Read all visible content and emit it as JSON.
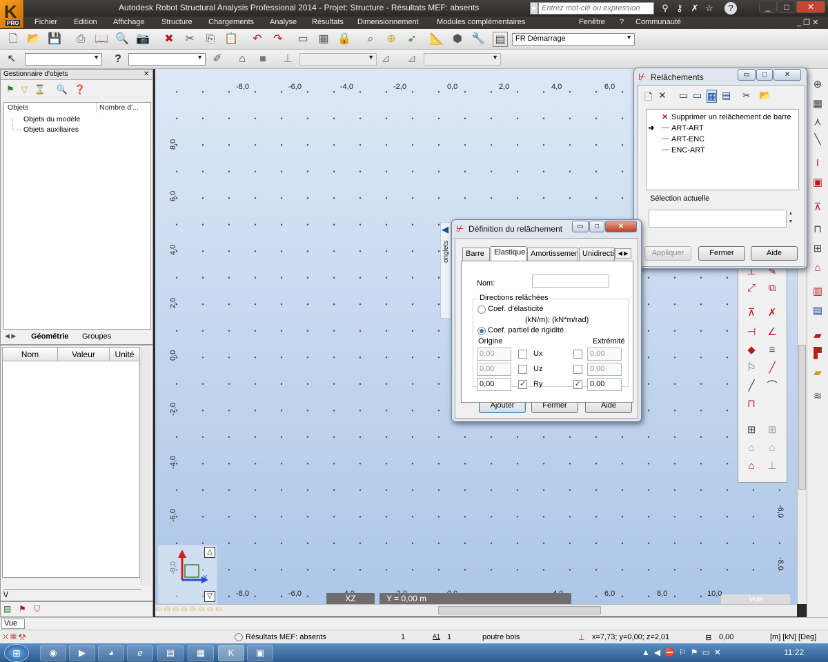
{
  "app": {
    "title": "Autodesk Robot Structural Analysis Professional 2014 - Projet: Structure - Résultats MEF: absents",
    "logo_letter": "K",
    "logo_badge": "PRO",
    "search_placeholder": "Entrez mot-clé ou expression",
    "window_controls": [
      "_",
      "□",
      "✕"
    ]
  },
  "menu": [
    "Fichier",
    "Edition",
    "Affichage",
    "Structure",
    "Chargements",
    "Analyse",
    "Résultats",
    "Dimensionnement",
    "Modules complémentaires",
    "Fenêtre",
    "?",
    "Communauté"
  ],
  "toolbar": {
    "workspace_combo": "FR Démarrage",
    "label_question": "?"
  },
  "object_manager": {
    "title": "Gestionnaire d'objets",
    "col_objects": "Objets",
    "col_count": "Nombre d'...",
    "items": [
      "Objets du modèle",
      "Objets auxiliaires"
    ],
    "tabs": [
      "Géométrie",
      "Groupes"
    ]
  },
  "properties": {
    "col_name": "Nom",
    "col_value": "Valeur",
    "col_unit": "Unité"
  },
  "canvas": {
    "top_ruler": [
      "-8,0",
      "-6,0",
      "-4,0",
      "-2,0",
      "0,0",
      "2,0",
      "4,0",
      "6,0"
    ],
    "left_ruler": [
      "8,0",
      "6,0",
      "4,0",
      "2,0",
      "0,0",
      "-2,0",
      "-4,0",
      "-6,0",
      "-8,0"
    ],
    "right_ruler": [
      "-6,0",
      "-8,0"
    ],
    "bottom_ruler": [
      "-8,0",
      "-6,0",
      "-4,0",
      "-2,0",
      "0,0",
      "4,0",
      "6,0",
      "8,0",
      "10,0"
    ],
    "view_plane": "XZ",
    "view_y": "Y = 0,00 m",
    "view_label": "Vue",
    "axis_z": "Z",
    "axis_x": "X",
    "side_tab": "onglets"
  },
  "releases_window": {
    "title": "Relâchements",
    "list": [
      {
        "icon": "✕",
        "label": "Supprimer un relâchement de barre",
        "current": false
      },
      {
        "icon": "—",
        "label": "ART-ART",
        "current": true
      },
      {
        "icon": "—",
        "label": "ART-ENC",
        "current": false
      },
      {
        "icon": "—",
        "label": "ENC-ART",
        "current": false
      }
    ],
    "selection_label": "Sélection actuelle",
    "selection_value": "",
    "buttons": {
      "apply": "Appliquer",
      "close": "Fermer",
      "help": "Aide"
    }
  },
  "definition_dialog": {
    "title": "Définition du relâchement",
    "tabs": [
      "Barre",
      "Elastique",
      "Amortissement",
      "Unidirectio"
    ],
    "active_tab": "Elastique",
    "name_label": "Nom:",
    "name_value": "",
    "group_label": "Directions relâchées",
    "radio_elasticity": "Coef. d'élasticité",
    "units": "(kN/m);  (kN*m/rad)",
    "radio_partial": "Coef. partiel de rigidité",
    "origin_label": "Origine",
    "end_label": "Extrémité",
    "rows": [
      {
        "dir": "Ux",
        "origin": "0,00",
        "origin_checked": false,
        "end": "0,00",
        "end_checked": false,
        "enabled": false
      },
      {
        "dir": "Uz",
        "origin": "0,00",
        "origin_checked": false,
        "end": "0,00",
        "end_checked": false,
        "enabled": false
      },
      {
        "dir": "Ry",
        "origin": "0,00",
        "origin_checked": true,
        "end": "0,00",
        "end_checked": true,
        "enabled": true
      }
    ],
    "buttons": {
      "add": "Ajouter",
      "close": "Fermer",
      "help": "Aide"
    }
  },
  "vue_bar": "Vue",
  "status": {
    "results": "Résultats MEF: absents",
    "case_num": "1",
    "case_label": "1",
    "material": "poutre bois",
    "coords": "x=7,73; y=0,00; z=2,01",
    "angle": "0,00",
    "units": "[m] [kN] [Deg]"
  },
  "taskbar": {
    "clock": "11:22"
  }
}
